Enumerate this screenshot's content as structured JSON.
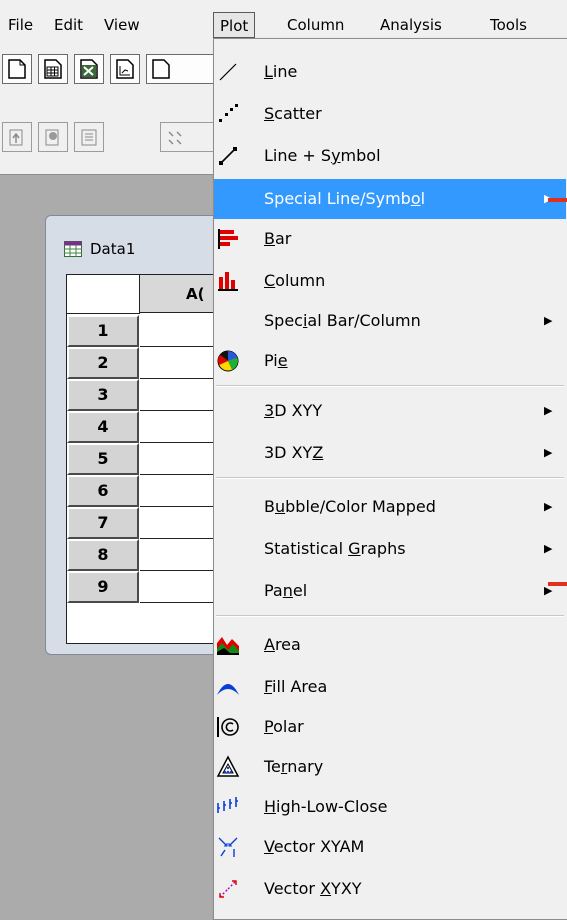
{
  "menubar": {
    "items": [
      {
        "label": "File"
      },
      {
        "label": "Edit"
      },
      {
        "label": "View"
      },
      {
        "label": "Plot"
      },
      {
        "label": "Column"
      },
      {
        "label": "Analysis"
      },
      {
        "label": "Tools"
      }
    ],
    "active": "Plot"
  },
  "datawin": {
    "title": "Data1",
    "column_header": "A(",
    "rows": [
      "1",
      "2",
      "3",
      "4",
      "5",
      "6",
      "7",
      "8",
      "9"
    ]
  },
  "plot_menu": {
    "highlighted": "Special Line/Symbol",
    "items": [
      {
        "pre": "",
        "ul": "L",
        "post": "ine",
        "icon": "line-icon"
      },
      {
        "pre": "",
        "ul": "S",
        "post": "catter",
        "icon": "scatter-icon"
      },
      {
        "pre": "Line + S",
        "ul": "y",
        "post": "mbol",
        "icon": "line-symbol-icon"
      },
      {
        "pre": "Special Line/Symb",
        "ul": "o",
        "post": "l",
        "icon": "",
        "submenu": true
      },
      {
        "pre": "",
        "ul": "B",
        "post": "ar",
        "icon": "bar-icon"
      },
      {
        "pre": "",
        "ul": "C",
        "post": "olumn",
        "icon": "column-icon"
      },
      {
        "pre": "Spec",
        "ul": "i",
        "post": "al Bar/Column",
        "icon": "",
        "submenu": true
      },
      {
        "pre": "Pi",
        "ul": "e",
        "post": "",
        "icon": "pie-icon"
      },
      {
        "pre": "",
        "ul": "3",
        "post": "D XYY",
        "icon": "",
        "submenu": true
      },
      {
        "pre": "3D XY",
        "ul": "Z",
        "post": "",
        "icon": "",
        "submenu": true
      },
      {
        "pre": "B",
        "ul": "u",
        "post": "bble/Color Mapped",
        "icon": "",
        "submenu": true
      },
      {
        "pre": "Statistical ",
        "ul": "G",
        "post": "raphs",
        "icon": "",
        "submenu": true
      },
      {
        "pre": "Pa",
        "ul": "n",
        "post": "el",
        "icon": "",
        "submenu": true
      },
      {
        "pre": "",
        "ul": "A",
        "post": "rea",
        "icon": "area-icon"
      },
      {
        "pre": "",
        "ul": "F",
        "post": "ill Area",
        "icon": "fill-area-icon"
      },
      {
        "pre": "",
        "ul": "P",
        "post": "olar",
        "icon": "polar-icon"
      },
      {
        "pre": "Te",
        "ul": "r",
        "post": "nary",
        "icon": "ternary-icon"
      },
      {
        "pre": "",
        "ul": "H",
        "post": "igh-Low-Close",
        "icon": "high-low-close-icon"
      },
      {
        "pre": "",
        "ul": "V",
        "post": "ector XYAM",
        "icon": "vector-xyam-icon"
      },
      {
        "pre": "Vector ",
        "ul": "X",
        "post": "YXY",
        "icon": "vector-xyxy-icon"
      }
    ]
  },
  "colors": {
    "menu_bg": "#f0f0f0",
    "highlight": "#3399ff",
    "workspace": "#ababab",
    "annotation_red": "#e0301e"
  }
}
